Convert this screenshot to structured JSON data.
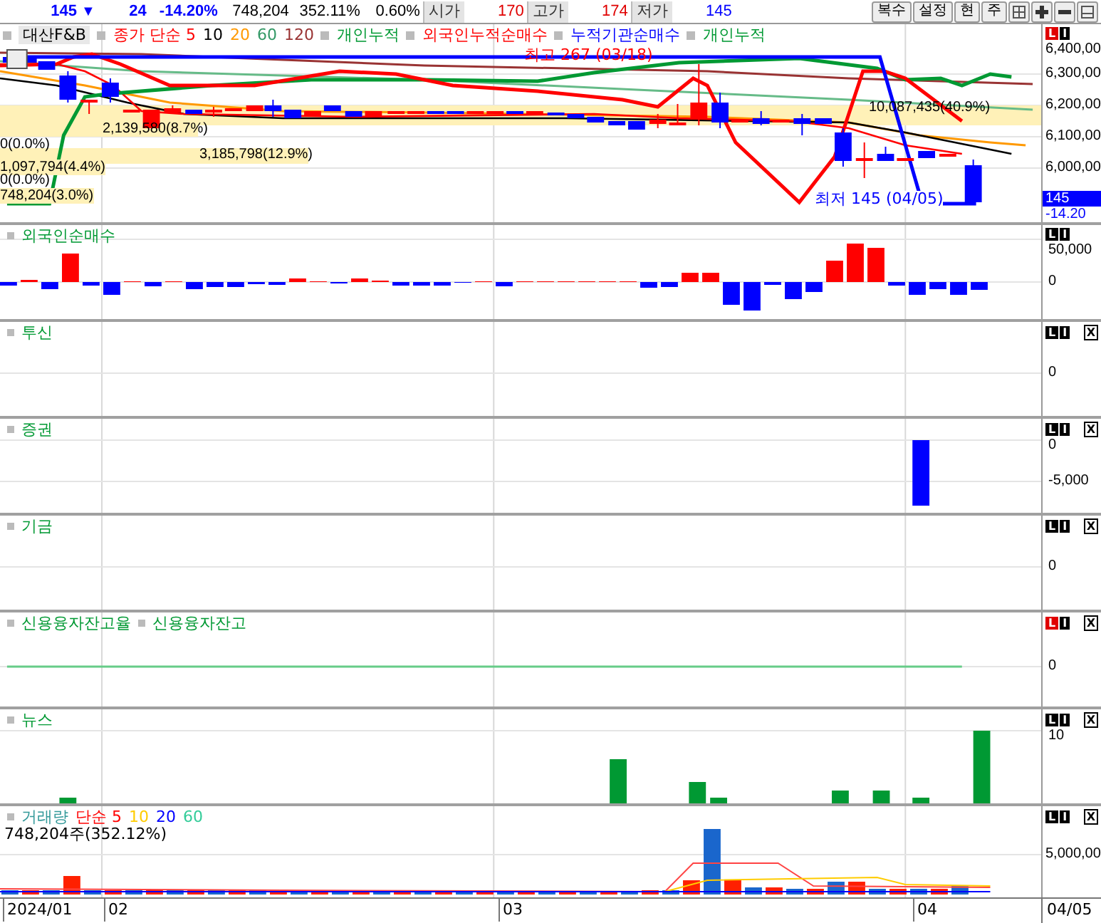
{
  "toolbar": {
    "price": "145",
    "arrow": "▼",
    "change": "24",
    "change_pct": "-14.20%",
    "volume": "748,204",
    "volume_ratio": "352.11%",
    "turnover": "0.60%",
    "fields": [
      {
        "label": "시가",
        "value": "170",
        "kind": "up"
      },
      {
        "label": "고가",
        "value": "174",
        "kind": "up"
      },
      {
        "label": "저가",
        "value": "145",
        "kind": "down"
      }
    ],
    "buttons": [
      "복수",
      "설정",
      "현",
      "주"
    ]
  },
  "main_chart": {
    "legend": [
      {
        "kind": "name",
        "label": "대산F&B"
      },
      {
        "kind": "group",
        "items": [
          {
            "label": "종가 단순 5",
            "color": "#ff0000"
          },
          {
            "label": "10",
            "color": "#000000"
          },
          {
            "label": "20",
            "color": "#ff9900"
          },
          {
            "label": "60",
            "color": "#339966"
          },
          {
            "label": "120",
            "color": "#993333"
          }
        ]
      },
      {
        "kind": "series",
        "label": "개인누적",
        "color": "#009933"
      },
      {
        "kind": "series",
        "label": "외국인누적순매수",
        "color": "#ff0000"
      },
      {
        "kind": "series",
        "label": "누적기관순매수",
        "color": "#0000ff"
      },
      {
        "kind": "series",
        "label": "개인누적",
        "color": "#009933"
      }
    ],
    "controls": [
      {
        "kind": "toggle",
        "label": "L",
        "active": true
      },
      {
        "kind": "toggle",
        "label": "I",
        "active": false
      }
    ],
    "high_label": "최고 267 (03/18)",
    "low_label": "최저 145 (04/05)",
    "profile_labels": [
      "10,087,435(40.9%)",
      "2,139,580(8.7%)",
      "0(0.0%)",
      "3,185,798(12.9%)",
      "1,097,794(4.4%)",
      "0(0.0%)",
      "748,204(3.0%)"
    ],
    "ticks": [
      "6,400,00",
      "6,300,00",
      "6,200,00",
      "6,100,00",
      "6,000,00"
    ],
    "price_tag": {
      "value": "145",
      "change": "-14.20"
    }
  },
  "panels": [
    {
      "kind": "foreign",
      "title": [
        "외국인순매수"
      ],
      "ticks": [
        "50,000",
        "0"
      ],
      "controls": [
        {
          "kind": "toggle",
          "label": "L",
          "active": false
        },
        {
          "kind": "toggle",
          "label": "I",
          "active": false
        }
      ]
    },
    {
      "kind": "blank",
      "title": [
        "투신"
      ],
      "ticks": [
        "0"
      ],
      "controls": [
        {
          "kind": "toggle",
          "label": "L",
          "active": false
        },
        {
          "kind": "toggle",
          "label": "I",
          "active": false
        },
        {
          "kind": "close",
          "label": "X"
        }
      ]
    },
    {
      "kind": "securities",
      "title": [
        "증권"
      ],
      "ticks": [
        "0",
        "-5,000"
      ],
      "controls": [
        {
          "kind": "toggle",
          "label": "L",
          "active": false
        },
        {
          "kind": "toggle",
          "label": "I",
          "active": false
        },
        {
          "kind": "close",
          "label": "X"
        }
      ]
    },
    {
      "kind": "blank",
      "title": [
        "기금"
      ],
      "ticks": [
        "0"
      ],
      "controls": [
        {
          "kind": "toggle",
          "label": "L",
          "active": false
        },
        {
          "kind": "toggle",
          "label": "I",
          "active": false
        },
        {
          "kind": "close",
          "label": "X"
        }
      ]
    },
    {
      "kind": "credit",
      "title": [
        "신용융자잔고율",
        "신용융자잔고"
      ],
      "ticks": [
        "0"
      ],
      "controls": [
        {
          "kind": "toggle",
          "label": "L",
          "active": true
        },
        {
          "kind": "toggle",
          "label": "I",
          "active": false
        },
        {
          "kind": "close",
          "label": "X"
        }
      ]
    },
    {
      "kind": "news",
      "title": [
        "뉴스"
      ],
      "ticks": [
        "10"
      ],
      "controls": [
        {
          "kind": "toggle",
          "label": "L",
          "active": false
        },
        {
          "kind": "toggle",
          "label": "I",
          "active": false
        },
        {
          "kind": "close",
          "label": "X"
        }
      ]
    }
  ],
  "volume": {
    "legend": [
      {
        "label": "거래량",
        "color": "#339999"
      },
      {
        "label": "단순 5",
        "color": "#ff0000"
      },
      {
        "label": "10",
        "color": "#ffcc00"
      },
      {
        "label": "20",
        "color": "#0000ff"
      },
      {
        "label": "60",
        "color": "#33cc99"
      }
    ],
    "info": "748,204주(352.12%)",
    "ticks": [
      "5,000,00"
    ],
    "controls": [
      {
        "kind": "toggle",
        "label": "L",
        "active": false
      },
      {
        "kind": "toggle",
        "label": "I",
        "active": false
      },
      {
        "kind": "close",
        "label": "X"
      }
    ]
  },
  "dates": [
    "2024/01",
    "02",
    "03",
    "04",
    "04/05"
  ]
}
